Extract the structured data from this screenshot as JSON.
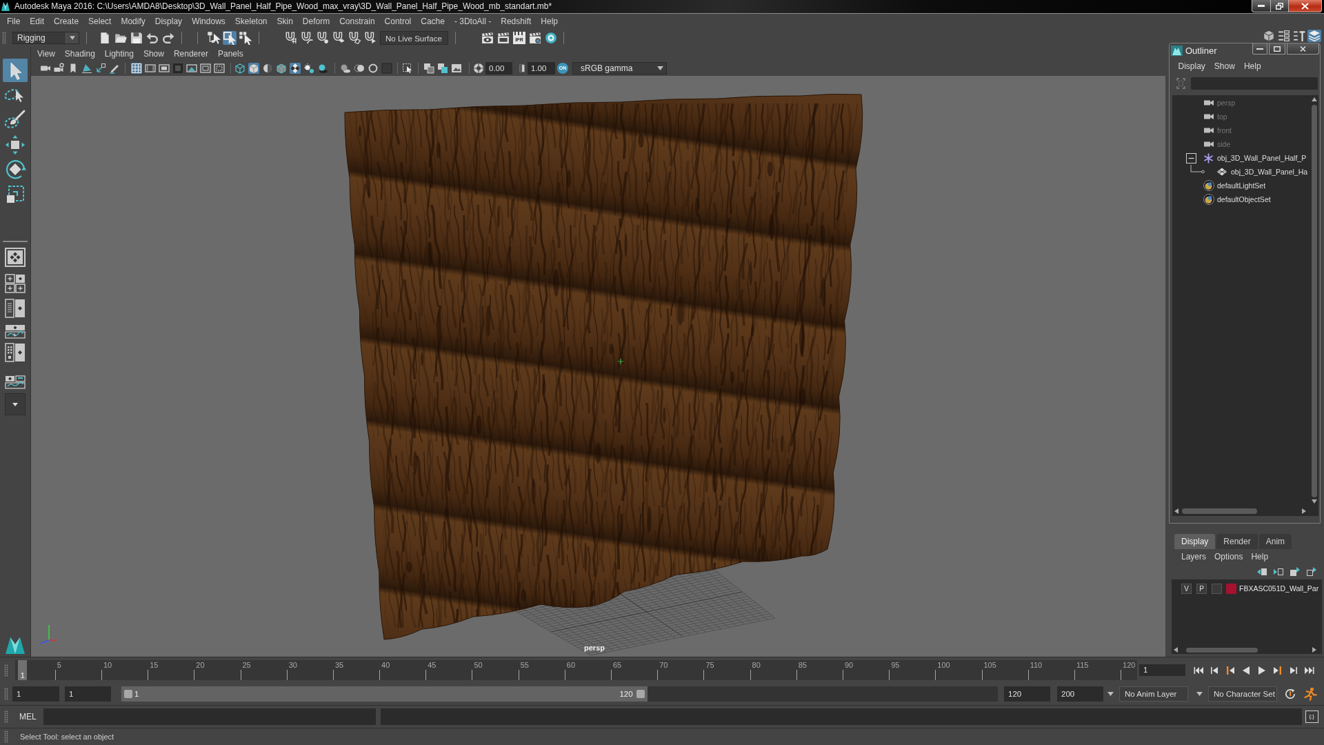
{
  "window": {
    "title": "Autodesk Maya 2016: C:\\Users\\AMDA8\\Desktop\\3D_Wall_Panel_Half_Pipe_Wood_max_vray\\3D_Wall_Panel_Half_Pipe_Wood_mb_standart.mb*"
  },
  "menu_bar": [
    "File",
    "Edit",
    "Create",
    "Select",
    "Modify",
    "Display",
    "Windows",
    "Skeleton",
    "Skin",
    "Deform",
    "Constrain",
    "Control",
    "Cache",
    "- 3DtoAll -",
    "Redshift",
    "Help"
  ],
  "status_line": {
    "workspace": "Rigging",
    "select_modes": [
      {
        "kind": "hierarchy",
        "selected": false
      },
      {
        "kind": "object",
        "selected": true
      },
      {
        "kind": "component",
        "selected": false
      }
    ],
    "live_surface": "No Live Surface",
    "ipr_label": "IPR",
    "panel_toggles": [
      {
        "kind": "modeling-toolkit",
        "on": false
      },
      {
        "kind": "attribute-editor",
        "on": false
      },
      {
        "kind": "tool-settings",
        "on": false
      },
      {
        "kind": "channel-box",
        "on": true
      }
    ]
  },
  "toolbox": {
    "tools": [
      {
        "kind": "select",
        "selected": true
      },
      {
        "kind": "lasso",
        "selected": false
      },
      {
        "kind": "paint",
        "selected": false
      },
      {
        "kind": "move",
        "selected": false
      },
      {
        "kind": "rotate",
        "selected": false
      },
      {
        "kind": "scale",
        "selected": false
      }
    ]
  },
  "viewport": {
    "menu": [
      "View",
      "Shading",
      "Lighting",
      "Show",
      "Renderer",
      "Panels"
    ],
    "toggle_groups": [
      [
        {
          "kind": "camera",
          "on": false
        },
        {
          "kind": "camera-attributes",
          "on": false
        },
        {
          "kind": "bookmark",
          "on": false
        },
        {
          "kind": "image-plane",
          "on": false
        },
        {
          "kind": "pan-zoom",
          "on": false
        },
        {
          "kind": "grease-pencil",
          "on": false
        }
      ],
      [
        {
          "kind": "grid",
          "on": true
        },
        {
          "kind": "film-gate",
          "on": false
        },
        {
          "kind": "resolution-gate",
          "on": false
        },
        {
          "kind": "gate-mask",
          "on": false
        },
        {
          "kind": "field-chart",
          "on": false
        },
        {
          "kind": "safe-action",
          "on": false
        },
        {
          "kind": "safe-title",
          "on": false
        }
      ],
      [
        {
          "kind": "wireframe",
          "on": false
        },
        {
          "kind": "smooth-shade",
          "on": true
        },
        {
          "kind": "default-material",
          "on": false
        },
        {
          "kind": "wire-on-shaded",
          "on": false
        },
        {
          "kind": "textured",
          "on": true
        },
        {
          "kind": "lights",
          "on": false
        },
        {
          "kind": "shadows",
          "on": false
        }
      ],
      [
        {
          "kind": "ambient-occlusion",
          "on": false
        },
        {
          "kind": "motion-blur",
          "on": false
        },
        {
          "kind": "anti-aliasing",
          "on": false
        },
        {
          "kind": "depth-of-field",
          "on": false
        }
      ],
      [
        {
          "kind": "isolate-select",
          "on": false
        }
      ],
      [
        {
          "kind": "xray",
          "on": false
        },
        {
          "kind": "xray-joints",
          "on": false
        },
        {
          "kind": "xray-components",
          "on": false
        }
      ]
    ],
    "exposure": "0.00",
    "gamma": "1.00",
    "color_management": {
      "label": "ON",
      "on": true
    },
    "color_space": "sRGB gamma",
    "camera_label": "persp"
  },
  "outliner": {
    "title": "Outliner",
    "menu": [
      "Display",
      "Show",
      "Help"
    ],
    "items": [
      {
        "kind": "camera",
        "label": "persp",
        "dimmed": true
      },
      {
        "kind": "camera",
        "label": "top",
        "dimmed": true
      },
      {
        "kind": "camera",
        "label": "front",
        "dimmed": true
      },
      {
        "kind": "camera",
        "label": "side",
        "dimmed": true
      },
      {
        "kind": "group",
        "label": "obj_3D_Wall_Panel_Half_P",
        "dimmed": false,
        "expanded": true,
        "children": [
          {
            "kind": "mesh",
            "label": "obj_3D_Wall_Panel_Ha",
            "dimmed": false
          }
        ]
      },
      {
        "kind": "set",
        "label": "defaultLightSet",
        "dimmed": false
      },
      {
        "kind": "set",
        "label": "defaultObjectSet",
        "dimmed": false
      }
    ]
  },
  "layer_editor": {
    "tabs": [
      {
        "label": "Display",
        "selected": true
      },
      {
        "label": "Render",
        "selected": false
      },
      {
        "label": "Anim",
        "selected": false
      }
    ],
    "menu": [
      "Layers",
      "Options",
      "Help"
    ],
    "layers": [
      {
        "visibility": "V",
        "playback": "P",
        "color": "#a5122f",
        "name": "FBXASC051D_Wall_Par"
      }
    ]
  },
  "time_slider": {
    "current_frame": "1",
    "level": 0,
    "ticks": [
      "5",
      "10",
      "15",
      "20",
      "25",
      "30",
      "35",
      "40",
      "45",
      "50",
      "55",
      "60",
      "65",
      "70",
      "75",
      "80",
      "85",
      "90",
      "95",
      "100",
      "105",
      "110",
      "115",
      "120"
    ],
    "current_frame_field": "1"
  },
  "range_slider": {
    "start_field": "1",
    "range_start_field": "1",
    "range_start": "1",
    "range_end": "120",
    "level": 0.6,
    "range_end_field": "120",
    "end_field": "200",
    "anim_layer": "No Anim Layer",
    "character_set": "No Character Set"
  },
  "command_line": {
    "language": "MEL",
    "script_editor_label": "{;}"
  },
  "help_line": "Select Tool: select an object"
}
